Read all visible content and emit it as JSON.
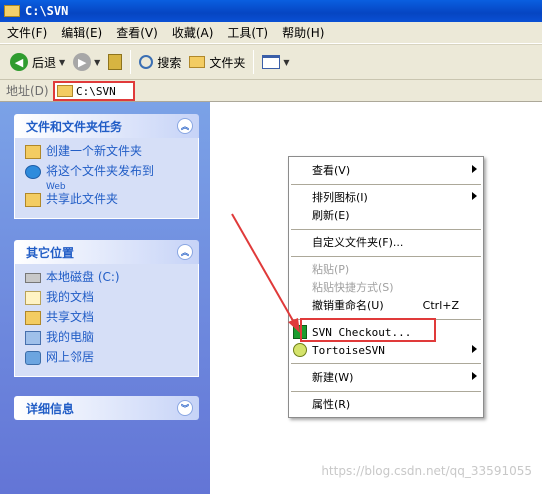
{
  "window": {
    "title": "C:\\SVN"
  },
  "menubar": [
    "文件(F)",
    "编辑(E)",
    "查看(V)",
    "收藏(A)",
    "工具(T)",
    "帮助(H)"
  ],
  "toolbar": {
    "back": "后退",
    "search": "搜索",
    "folders": "文件夹"
  },
  "address": {
    "label": "地址(D)",
    "value": "C:\\SVN"
  },
  "tasks_panel": {
    "title": "文件和文件夹任务",
    "items": [
      {
        "label": "创建一个新文件夹"
      },
      {
        "label": "将这个文件夹发布到",
        "sub": "Web"
      },
      {
        "label": "共享此文件夹"
      }
    ]
  },
  "places_panel": {
    "title": "其它位置",
    "items": [
      {
        "label": "本地磁盘 (C:)"
      },
      {
        "label": "我的文档"
      },
      {
        "label": "共享文档"
      },
      {
        "label": "我的电脑"
      },
      {
        "label": "网上邻居"
      }
    ]
  },
  "details_panel": {
    "title": "详细信息"
  },
  "context_menu": {
    "view": "查看(V)",
    "arrange": "排列图标(I)",
    "refresh": "刷新(E)",
    "customize": "自定义文件夹(F)...",
    "paste": "粘贴(P)",
    "paste_shortcut": "粘贴快捷方式(S)",
    "undo_rename": "撤销重命名(U)",
    "undo_shortcut": "Ctrl+Z",
    "svn_checkout": "SVN Checkout...",
    "tortoise": "TortoiseSVN",
    "new": "新建(W)",
    "properties": "属性(R)"
  },
  "watermark": "https://blog.csdn.net/qq_33591055",
  "colors": {
    "highlight_box": "#e03a3a",
    "title_blue": "#0645c2",
    "task_link": "#215dc6"
  }
}
